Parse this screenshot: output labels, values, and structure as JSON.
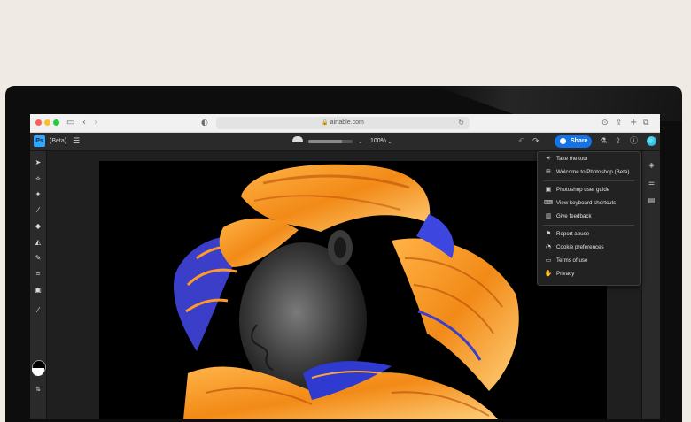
{
  "browser": {
    "url": "airtable.com",
    "icons": {
      "sidebar": "sidebar-icon",
      "back": "chevron-left-icon",
      "forward": "chevron-right-icon",
      "shield": "shield-icon",
      "lock": "lock-icon",
      "reload": "reload-icon",
      "download": "download-icon",
      "share": "share-icon",
      "new_tab": "plus-icon",
      "tabs": "tabs-icon"
    }
  },
  "app": {
    "logo_text": "Ps",
    "badge": "(Beta)",
    "zoom": "100%",
    "share_label": "Share",
    "upload_progress": 0.75,
    "colors": {
      "accent": "#1473e6",
      "logo": "#31a8ff",
      "background": "#2a2a2a",
      "canvas": "#000000"
    },
    "icons": {
      "menu": "hamburger-icon",
      "cloud": "cloud-icon",
      "undo": "undo-icon",
      "redo": "redo-icon",
      "flask": "flask-icon",
      "help": "help-icon",
      "avatar": "avatar-icon"
    }
  },
  "tools": [
    "select-tool",
    "lasso-tool",
    "quick-select-tool",
    "brush-tool",
    "eraser-tool",
    "fill-tool",
    "healing-tool",
    "crop-tool",
    "image-tool",
    "eyedropper-tool"
  ],
  "color_swatches": {
    "foreground": "#000000",
    "background": "#ffffff"
  },
  "right_rail": [
    "layers-icon",
    "adjustments-icon",
    "comments-icon"
  ],
  "menu": {
    "items": [
      {
        "label": "Take the tour",
        "icon": "lightbulb-icon"
      },
      {
        "label": "Welcome to Photoshop (Beta)",
        "icon": "grid-icon"
      },
      {
        "label": "Photoshop user guide",
        "icon": "ps-guide-icon"
      },
      {
        "label": "View keyboard shortcuts",
        "icon": "keyboard-icon"
      },
      {
        "label": "Give feedback",
        "icon": "feedback-icon"
      },
      {
        "label": "Report abuse",
        "icon": "flag-icon"
      },
      {
        "label": "Cookie preferences",
        "icon": "cookie-icon"
      },
      {
        "label": "Terms of use",
        "icon": "document-icon"
      },
      {
        "label": "Privacy",
        "icon": "hand-icon"
      }
    ]
  }
}
